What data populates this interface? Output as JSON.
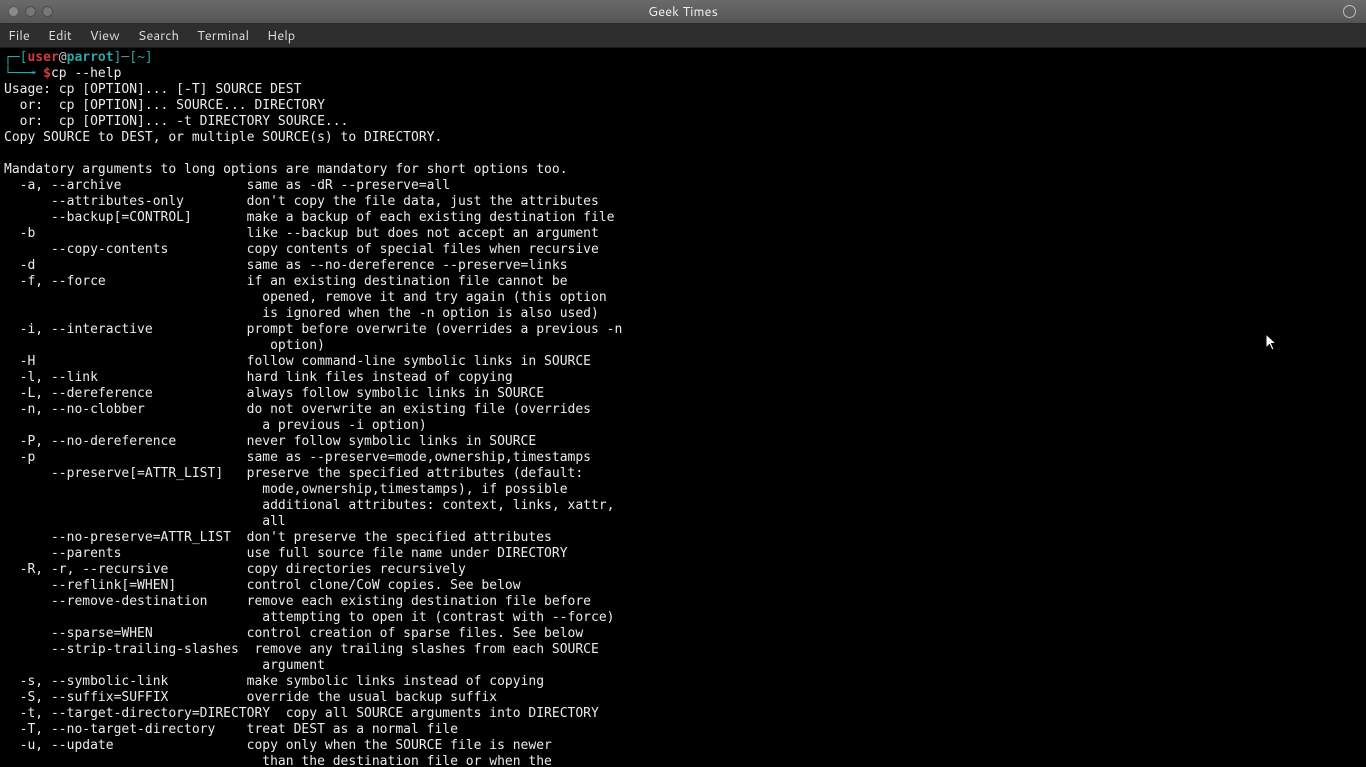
{
  "window": {
    "title": "Geek Times"
  },
  "menu": {
    "file": "File",
    "edit": "Edit",
    "view": "View",
    "search": "Search",
    "terminal": "Terminal",
    "help": "Help"
  },
  "prompt": {
    "lb1": "┌─[",
    "user": "user",
    "at": "@",
    "host": "parrot",
    "rb1": "]",
    "dash": "─",
    "lb2": "[",
    "path": "~",
    "rb2": "]",
    "tree": "└──╼ ",
    "dollar": "$",
    "command": "cp --help"
  },
  "output": "Usage: cp [OPTION]... [-T] SOURCE DEST\n  or:  cp [OPTION]... SOURCE... DIRECTORY\n  or:  cp [OPTION]... -t DIRECTORY SOURCE...\nCopy SOURCE to DEST, or multiple SOURCE(s) to DIRECTORY.\n\nMandatory arguments to long options are mandatory for short options too.\n  -a, --archive                same as -dR --preserve=all\n      --attributes-only        don't copy the file data, just the attributes\n      --backup[=CONTROL]       make a backup of each existing destination file\n  -b                           like --backup but does not accept an argument\n      --copy-contents          copy contents of special files when recursive\n  -d                           same as --no-dereference --preserve=links\n  -f, --force                  if an existing destination file cannot be\n                                 opened, remove it and try again (this option\n                                 is ignored when the -n option is also used)\n  -i, --interactive            prompt before overwrite (overrides a previous -n\n                                  option)\n  -H                           follow command-line symbolic links in SOURCE\n  -l, --link                   hard link files instead of copying\n  -L, --dereference            always follow symbolic links in SOURCE\n  -n, --no-clobber             do not overwrite an existing file (overrides\n                                 a previous -i option)\n  -P, --no-dereference         never follow symbolic links in SOURCE\n  -p                           same as --preserve=mode,ownership,timestamps\n      --preserve[=ATTR_LIST]   preserve the specified attributes (default:\n                                 mode,ownership,timestamps), if possible\n                                 additional attributes: context, links, xattr,\n                                 all\n      --no-preserve=ATTR_LIST  don't preserve the specified attributes\n      --parents                use full source file name under DIRECTORY\n  -R, -r, --recursive          copy directories recursively\n      --reflink[=WHEN]         control clone/CoW copies. See below\n      --remove-destination     remove each existing destination file before\n                                 attempting to open it (contrast with --force)\n      --sparse=WHEN            control creation of sparse files. See below\n      --strip-trailing-slashes  remove any trailing slashes from each SOURCE\n                                 argument\n  -s, --symbolic-link          make symbolic links instead of copying\n  -S, --suffix=SUFFIX          override the usual backup suffix\n  -t, --target-directory=DIRECTORY  copy all SOURCE arguments into DIRECTORY\n  -T, --no-target-directory    treat DEST as a normal file\n  -u, --update                 copy only when the SOURCE file is newer\n                                 than the destination file or when the"
}
